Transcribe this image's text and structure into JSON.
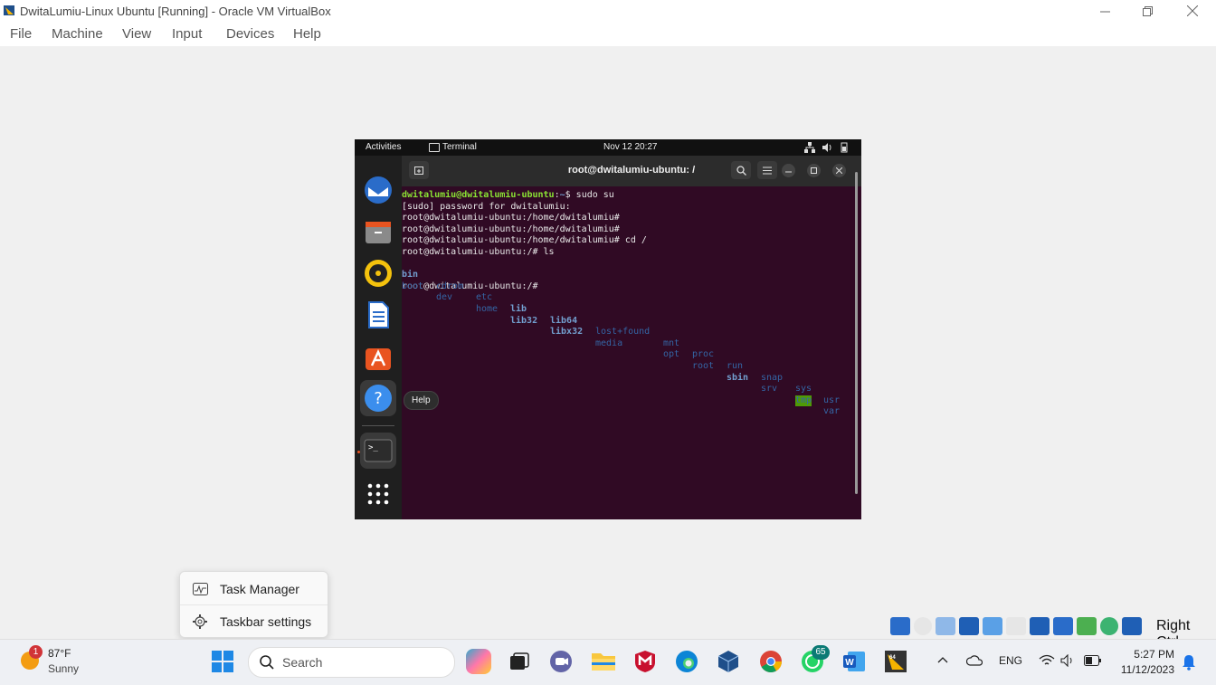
{
  "window": {
    "title": "DwitaLumiu-Linux Ubuntu [Running] - Oracle VM VirtualBox",
    "menu": [
      "File",
      "Machine",
      "View",
      "Input",
      "Devices",
      "Help"
    ]
  },
  "vm": {
    "topbar": {
      "activities": "Activities",
      "app": "Terminal",
      "datetime": "Nov 12  20:27"
    },
    "terminal": {
      "title": "root@dwitalumiu-ubuntu: /",
      "line1_prompt": "dwitalumiu@dwitalumiu-ubuntu",
      "line1_sep": ":",
      "line1_path": "~",
      "line1_cmd": "$ sudo su",
      "line2": "[sudo] password for dwitalumiu:",
      "line3": "root@dwitalumiu-ubuntu:/home/dwitalumiu#",
      "line4": "root@dwitalumiu-ubuntu:/home/dwitalumiu#",
      "line5": "root@dwitalumiu-ubuntu:/home/dwitalumiu# cd /",
      "line6": "root@dwitalumiu-ubuntu:/# ls",
      "ls_row1": [
        "bin",
        "cdrom",
        "etc",
        "lib",
        "lib64",
        "lost+found",
        "mnt",
        "proc",
        "run",
        "snap",
        "sys",
        "usr"
      ],
      "ls_row2": [
        "boot",
        "dev",
        "home",
        "lib32",
        "libx32",
        "media",
        "opt",
        "root",
        "sbin",
        "srv",
        "tmp",
        "var"
      ],
      "line9": "root@dwitalumiu-ubuntu:/#"
    },
    "dock_tooltip": "Help"
  },
  "context_menu": {
    "task_manager": "Task Manager",
    "taskbar_settings": "Taskbar settings"
  },
  "host_key": "Right Ctrl",
  "taskbar": {
    "weather_temp": "87°F",
    "weather_cond": "Sunny",
    "weather_badge": "1",
    "search_placeholder": "Search",
    "whatsapp_badge": "65",
    "lang": "ENG",
    "time": "5:27 PM",
    "date": "11/12/2023"
  }
}
